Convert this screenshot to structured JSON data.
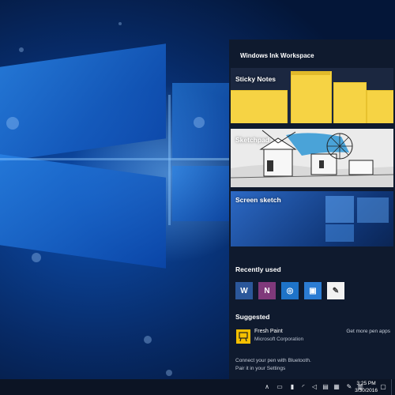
{
  "panel": {
    "title": "Windows Ink Workspace",
    "sticky_notes_label": "Sticky Notes",
    "sketchpad_label": "Sketchpad",
    "screen_sketch_label": "Screen sketch"
  },
  "recently_used": {
    "heading": "Recently used",
    "apps": [
      {
        "name": "word-icon",
        "color": "#2b579a",
        "glyph": "W"
      },
      {
        "name": "onenote-icon",
        "color": "#80397b",
        "glyph": "N"
      },
      {
        "name": "maps-icon",
        "color": "#1e73c8",
        "glyph": "◎"
      },
      {
        "name": "photos-icon",
        "color": "#2b7cd3",
        "glyph": "▣"
      },
      {
        "name": "pen-app-icon",
        "color": "#f2f2f2",
        "glyph": "✎"
      }
    ]
  },
  "suggested": {
    "heading": "Suggested",
    "app_name": "Fresh Paint",
    "publisher": "Microsoft Corporation",
    "more_link": "Get more pen apps"
  },
  "hint": {
    "line1": "Connect your pen with Bluetooth.",
    "line2": "Pair it in your Settings"
  },
  "taskbar": {
    "time": "3:25 PM",
    "date": "3/30/2016"
  },
  "colors": {
    "panel_bg": "#0f1a2e",
    "sticky_yellow": "#f6d344",
    "accent": "#1e73c8"
  }
}
